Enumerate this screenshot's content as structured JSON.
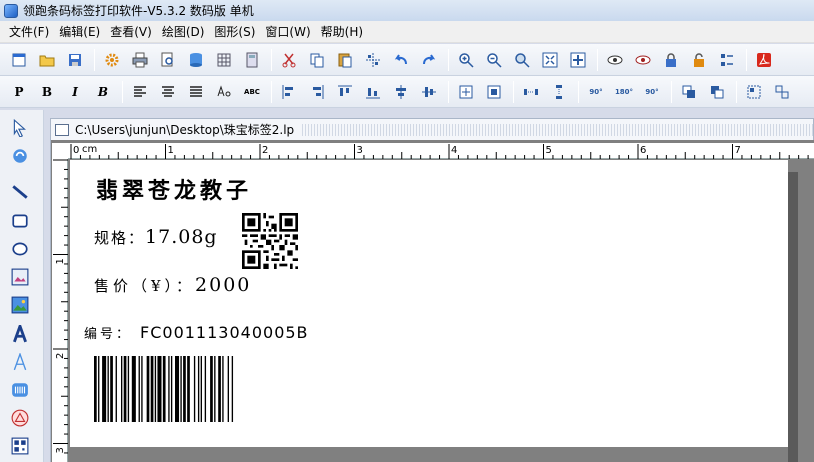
{
  "window": {
    "title": "领跑条码标签打印软件-V5.3.2 数码版 单机"
  },
  "menu": [
    "文件(F)",
    "编辑(E)",
    "查看(V)",
    "绘图(D)",
    "图形(S)",
    "窗口(W)",
    "帮助(H)"
  ],
  "toolbar2_text": {
    "para": "P",
    "bold": "B",
    "italic": "I",
    "bold_italic": "B",
    "abc": "ABC",
    "rot90": "90°",
    "rot180": "180°",
    "rot90b": "90°"
  },
  "document": {
    "path": "C:\\Users\\junjun\\Desktop\\珠宝标签2.lp"
  },
  "ruler": {
    "unit": "cm",
    "top_marks": [
      "0",
      "1",
      "2",
      "3",
      "4",
      "5",
      "6",
      "7"
    ],
    "left_marks": [
      "1",
      "2",
      "3"
    ]
  },
  "label": {
    "title": "翡翠苍龙教子",
    "spec_key": "规格：",
    "spec_value": "17.08g",
    "price_key": "售价（¥）：",
    "price_value": "2000",
    "code_key": "编号：",
    "code_value": "FC001113040005B"
  },
  "colors": {
    "accent": "#1b3f8b",
    "canvas": "#808080"
  }
}
